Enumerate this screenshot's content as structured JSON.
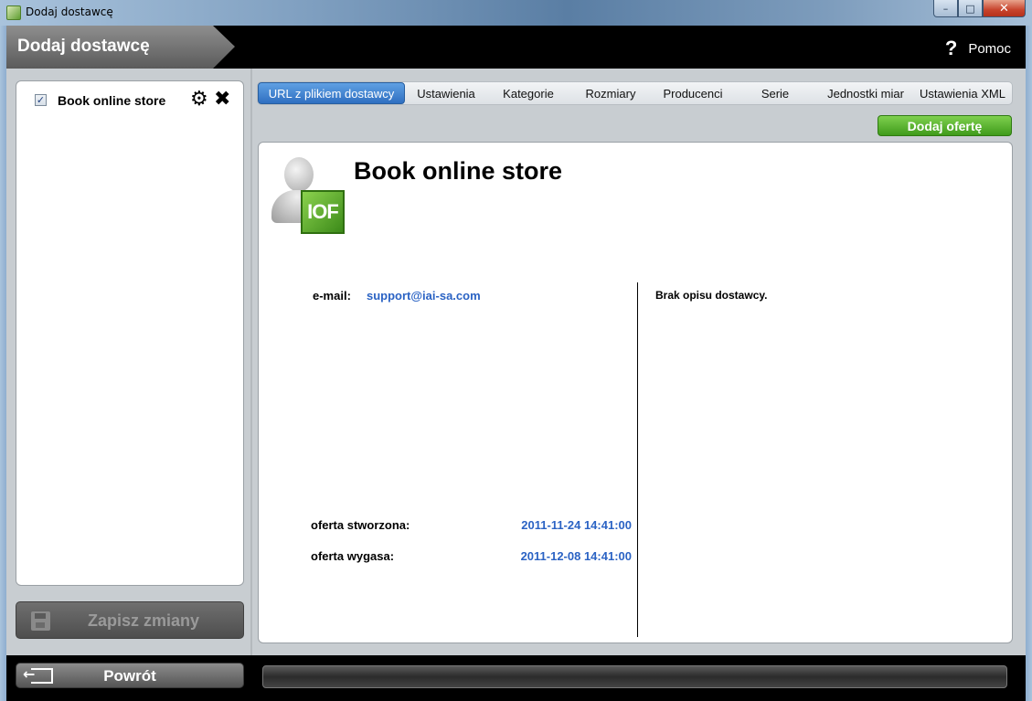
{
  "window": {
    "title": "Dodaj dostawcę",
    "controls": {
      "minimize": "–",
      "maximize": "□",
      "close": "✕"
    }
  },
  "header": {
    "title": "Dodaj dostawcę",
    "help_icon": "?",
    "help_label": "Pomoc"
  },
  "sidebar": {
    "items": [
      {
        "label": "Book online store",
        "checked": true,
        "check_glyph": "✓",
        "gear_glyph": "⚙",
        "delete_glyph": "✖"
      }
    ],
    "save_label": "Zapisz zmiany"
  },
  "tabs": [
    {
      "label": "URL z plikiem dostawcy",
      "active": true
    },
    {
      "label": "Ustawienia",
      "active": false
    },
    {
      "label": "Kategorie",
      "active": false
    },
    {
      "label": "Rozmiary",
      "active": false
    },
    {
      "label": "Producenci",
      "active": false
    },
    {
      "label": "Serie",
      "active": false
    },
    {
      "label": "Jednostki miar",
      "active": false
    },
    {
      "label": "Ustawienia XML",
      "active": false
    }
  ],
  "add_offer_label": "Dodaj ofertę",
  "supplier": {
    "logo_text": "IOF",
    "name": "Book online store",
    "email_label": "e-mail:",
    "email": "support@iai-sa.com",
    "description": "Brak opisu dostawcy.",
    "created_label": "oferta stworzona:",
    "created_value": "2011-11-24 14:41:00",
    "expires_label": "oferta wygasa:",
    "expires_value": "2011-12-08 14:41:00"
  },
  "footer": {
    "back_label": "Powrót"
  },
  "colors": {
    "accent_blue": "#2f6fc1",
    "accent_green": "#3f9b1b",
    "link_blue": "#2b63c4"
  }
}
